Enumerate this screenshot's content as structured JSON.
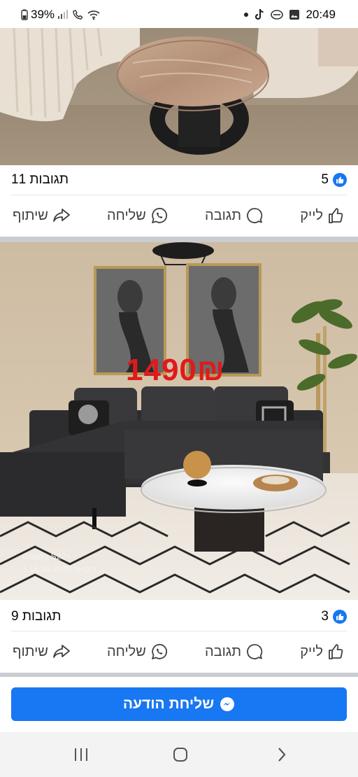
{
  "status_bar": {
    "battery": "39%",
    "time": "20:49"
  },
  "post1": {
    "likes_count": "5",
    "comments_text": "11 תגובות"
  },
  "post2": {
    "price_text": "1490₪",
    "camera_watermark_line1": "Galaxy S22+",
    "camera_watermark_line2": "2 בינואר 2024 16:31",
    "likes_count": "3",
    "comments_text": "9 תגובות"
  },
  "actions": {
    "like": "לייק",
    "comment": "תגובה",
    "send": "שליחה",
    "share": "שיתוף"
  },
  "messenger_button": {
    "label": "שליחת הודעה"
  },
  "colors": {
    "brand_blue": "#1877f2",
    "price_red": "#e01a1a",
    "action_gray": "#404040"
  },
  "icons": [
    "like-icon",
    "comment-icon",
    "whatsapp-icon",
    "share-icon",
    "messenger-icon"
  ]
}
